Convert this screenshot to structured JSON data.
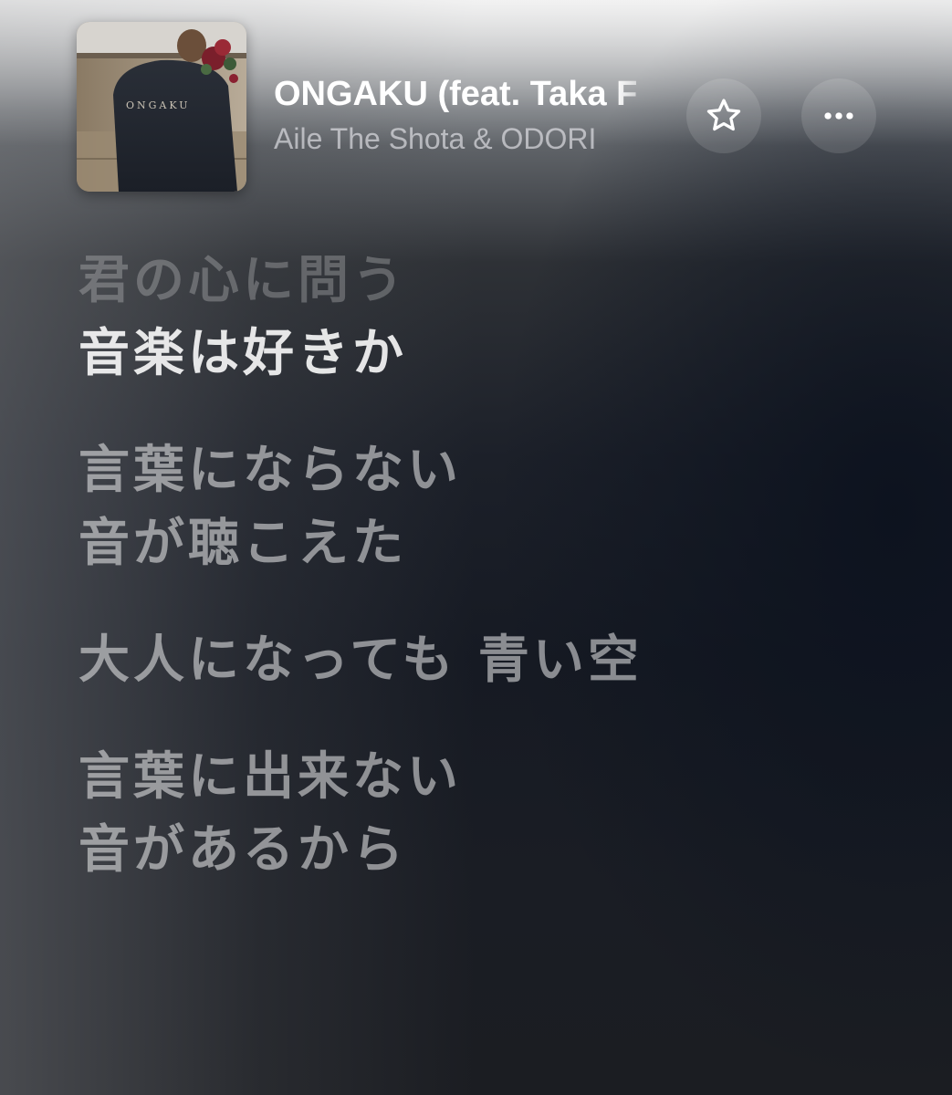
{
  "now_playing": {
    "title": "ONGAKU (feat. Taka F",
    "artist": "Aile The Shota & ODORI",
    "artwork_text": "ONGAKU"
  },
  "actions": {
    "favorite_icon": "star-outline-icon",
    "more_icon": "ellipsis-icon"
  },
  "lyrics": {
    "stanzas": [
      {
        "lines": [
          {
            "text": "君の心に問う",
            "state": "past"
          },
          {
            "text": "音楽は好きか",
            "state": "current"
          }
        ]
      },
      {
        "lines": [
          {
            "text": "言葉にならない",
            "state": "upcoming"
          },
          {
            "text": "音が聴こえた",
            "state": "upcoming"
          }
        ]
      },
      {
        "lines": [
          {
            "text": "大人になっても 青い空",
            "state": "upcoming"
          }
        ]
      },
      {
        "lines": [
          {
            "text": "言葉に出来ない",
            "state": "upcoming"
          },
          {
            "text": "音があるから",
            "state": "upcoming"
          }
        ]
      }
    ]
  },
  "colors": {
    "background_dark": "#161a23",
    "text_primary": "#ffffff",
    "text_secondary": "#a8a9ad"
  }
}
